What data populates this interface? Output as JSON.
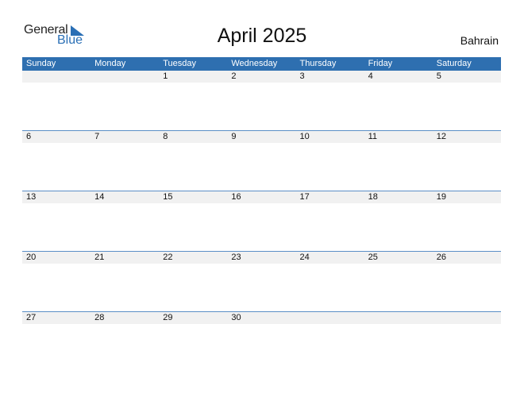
{
  "logo": {
    "text_general": "General",
    "text_blue": "Blue"
  },
  "title": "April 2025",
  "country": "Bahrain",
  "colors": {
    "header_bg": "#2e6fb0",
    "date_row_bg": "#f1f1f1",
    "row_line": "#5b8fc6",
    "logo_blue": "#2a6fb5"
  },
  "weekdays": [
    "Sunday",
    "Monday",
    "Tuesday",
    "Wednesday",
    "Thursday",
    "Friday",
    "Saturday"
  ],
  "weeks": [
    [
      "",
      "",
      "1",
      "2",
      "3",
      "4",
      "5"
    ],
    [
      "6",
      "7",
      "8",
      "9",
      "10",
      "11",
      "12"
    ],
    [
      "13",
      "14",
      "15",
      "16",
      "17",
      "18",
      "19"
    ],
    [
      "20",
      "21",
      "22",
      "23",
      "24",
      "25",
      "26"
    ],
    [
      "27",
      "28",
      "29",
      "30",
      "",
      "",
      ""
    ]
  ]
}
